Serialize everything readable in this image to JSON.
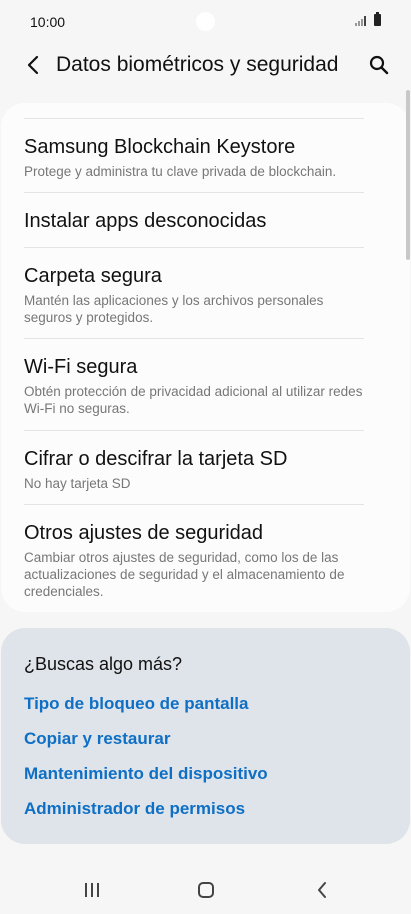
{
  "status_bar": {
    "time": "10:00",
    "signal_icon": "signal-icon",
    "battery_icon": "battery-icon"
  },
  "header": {
    "back_icon": "chevron-left-icon",
    "title": "Datos biométricos y seguridad",
    "search_icon": "search-icon"
  },
  "settings": {
    "items": [
      {
        "title": "Samsung Blockchain Keystore",
        "description": "Protege y administra tu clave privada de blockchain."
      },
      {
        "title": "Instalar apps desconocidas",
        "description": ""
      },
      {
        "title": "Carpeta segura",
        "description": "Mantén las aplicaciones y los archivos personales seguros y protegidos."
      },
      {
        "title": "Wi-Fi segura",
        "description": "Obtén protección de privacidad adicional al utilizar redes Wi-Fi no seguras."
      },
      {
        "title": "Cifrar o descifrar la tarjeta SD",
        "description": "No hay tarjeta SD"
      },
      {
        "title": "Otros ajustes de seguridad",
        "description": "Cambiar otros ajustes de seguridad, como los de las actualizaciones de seguridad y el almacenamiento de credenciales."
      }
    ]
  },
  "related": {
    "title": "¿Buscas algo más?",
    "links": [
      "Tipo de bloqueo de pantalla",
      "Copiar y restaurar",
      "Mantenimiento del dispositivo",
      "Administrador de permisos"
    ]
  },
  "nav_bar": {
    "recents_icon": "recents-icon",
    "home_icon": "home-icon",
    "back_icon": "back-icon"
  },
  "colors": {
    "background": "#f6f6f6",
    "card": "#fcfcfc",
    "related_card": "#dfe4ea",
    "link": "#0e6fc4",
    "secondary_text": "#777777"
  }
}
